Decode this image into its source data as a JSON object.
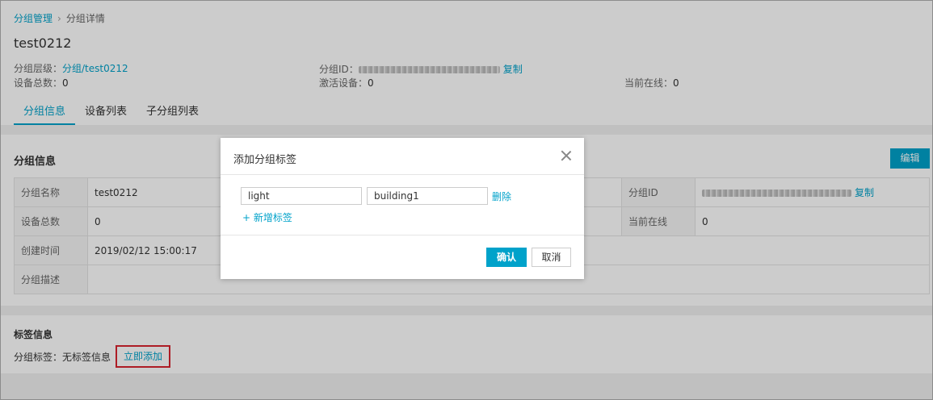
{
  "breadcrumb": {
    "root": "分组管理",
    "separator": "›",
    "current": "分组详情"
  },
  "page_title": "test0212",
  "summary": {
    "level_label": "分组层级：",
    "level_value": "分组/test0212",
    "group_id_label": "分组ID：",
    "copy_label": "复制",
    "device_total_label": "设备总数：",
    "device_total_value": "0",
    "active_label": "激活设备：",
    "active_value": "0",
    "online_label": "当前在线：",
    "online_value": "0"
  },
  "tabs": [
    {
      "label": "分组信息"
    },
    {
      "label": "设备列表"
    },
    {
      "label": "子分组列表"
    }
  ],
  "group_info": {
    "title": "分组信息",
    "edit_label": "编辑",
    "rows": [
      {
        "k1": "分组名称",
        "v1": "test0212",
        "k2": "分组ID",
        "copy": "复制"
      },
      {
        "k1": "设备总数",
        "v1": "0",
        "k2": "当前在线",
        "v2": "0"
      },
      {
        "k1": "创建时间",
        "v1": "2019/02/12 15:00:17"
      },
      {
        "k1": "分组描述",
        "v1": ""
      }
    ]
  },
  "tag_info": {
    "title": "标签信息",
    "tags_label": "分组标签：无标签信息",
    "add_now_label": "立即添加"
  },
  "modal": {
    "title": "添加分组标签",
    "tag_key_value": "light",
    "tag_value_value": "building1",
    "delete_label": "删除",
    "add_tag_label": "+ 新增标签",
    "confirm_label": "确认",
    "cancel_label": "取消"
  },
  "colors": {
    "accent": "#00a2ca",
    "highlight_border": "#d9232f",
    "overlay": "rgba(0,0,0,0.2)"
  }
}
